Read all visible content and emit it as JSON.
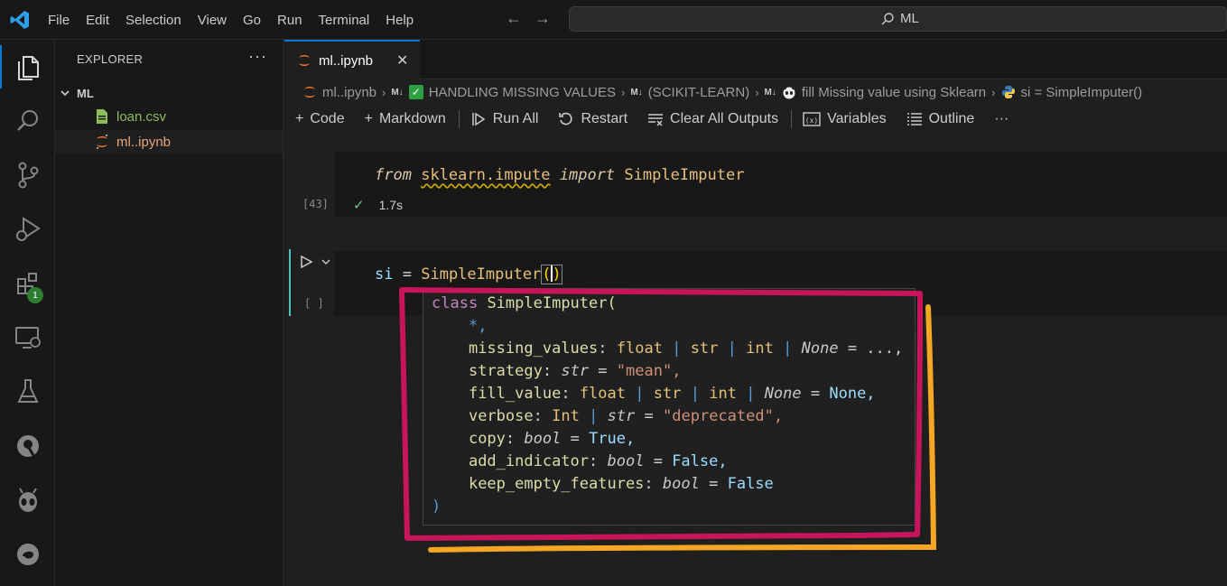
{
  "menu": [
    "File",
    "Edit",
    "Selection",
    "View",
    "Go",
    "Run",
    "Terminal",
    "Help"
  ],
  "search": {
    "text": "ML"
  },
  "activity": {
    "extensions_badge": "1"
  },
  "explorer": {
    "title": "EXPLORER",
    "more": "···",
    "root": "ML",
    "files": [
      {
        "name": "loan.csv",
        "icon": "csv-file-icon"
      },
      {
        "name": "ml..ipynb",
        "icon": "jupyter-icon"
      }
    ]
  },
  "tab": {
    "label": "ml..ipynb",
    "close": "✕"
  },
  "breadcrumb": {
    "file": "ml..ipynb",
    "section1": "HANDLING MISSING VALUES",
    "section2": "(SCIKIT-LEARN)",
    "section3": "fill Missing value using Sklearn",
    "symbol": "si = SimpleImputer()"
  },
  "toolbar": {
    "code": "Code",
    "markdown": "Markdown",
    "run_all": "Run All",
    "restart": "Restart",
    "clear_outputs": "Clear All Outputs",
    "variables": "Variables",
    "outline": "Outline",
    "more": "···"
  },
  "cell1": {
    "kw_from": "from",
    "module": "sklearn.impute",
    "kw_import": "import",
    "name": "SimpleImputer",
    "exec_count": "[43]",
    "duration": "1.7s"
  },
  "cell2": {
    "var": "si",
    "eq": "=",
    "call": "SimpleImputer",
    "exec_count": "[ ]"
  },
  "hover": {
    "kw_class": "class",
    "cls_name": "SimpleImputer(",
    "star": "*,",
    "params": [
      {
        "name": "missing_values",
        "sep": ":",
        "type_html": "float | str | int | None",
        "default": "...,"
      },
      {
        "name": "strategy",
        "sep": ":",
        "type_html": "str",
        "default": "\"mean\","
      },
      {
        "name": "fill_value",
        "sep": ":",
        "type_html": "float | str | int | None",
        "default": "None,"
      },
      {
        "name": "verbose",
        "sep": ":",
        "type_html": "Int | str",
        "default": "\"deprecated\","
      },
      {
        "name": "copy",
        "sep": ":",
        "type_html": "bool",
        "default": "True,"
      },
      {
        "name": "add_indicator",
        "sep": ":",
        "type_html": "bool",
        "default": "False,"
      },
      {
        "name": "keep_empty_features",
        "sep": ":",
        "type_html": "bool",
        "default": "False"
      }
    ],
    "close_paren": ")"
  },
  "colors": {
    "accent": "#0078d4",
    "annotation_red": "#c8145a",
    "annotation_orange": "#f5a623"
  }
}
